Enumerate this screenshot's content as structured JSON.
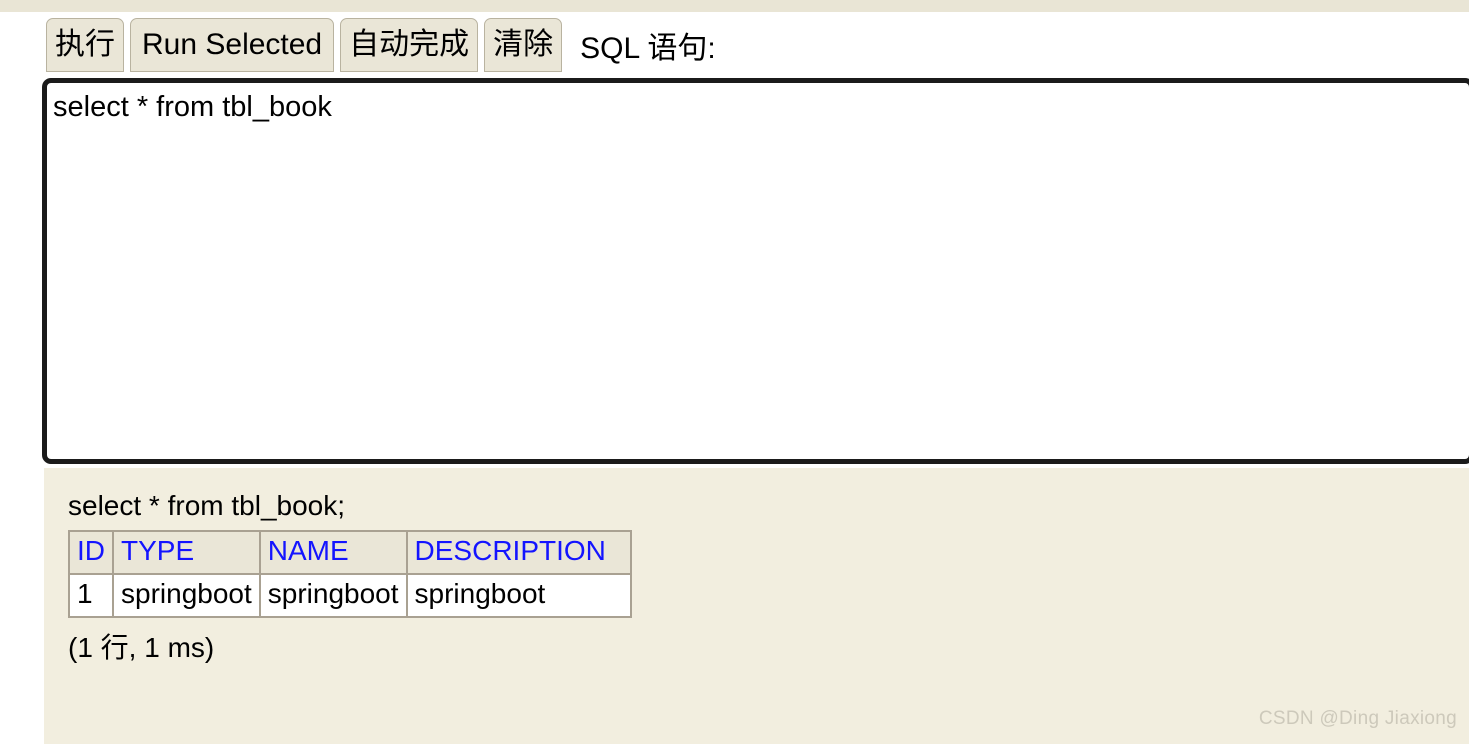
{
  "toolbar": {
    "buttons": [
      {
        "label": "执行",
        "name": "run-button",
        "cjk": true
      },
      {
        "label": "Run Selected",
        "name": "run-selected-button",
        "cjk": false
      },
      {
        "label": "自动完成",
        "name": "auto-complete-button",
        "cjk": true
      },
      {
        "label": "清除",
        "name": "clear-button",
        "cjk": true
      }
    ],
    "sql_label": "SQL 语句:"
  },
  "editor": {
    "value": "select * from tbl_book",
    "placeholder": ""
  },
  "results": {
    "query_echo": "select * from tbl_book;",
    "columns": [
      "ID",
      "TYPE",
      "NAME",
      "DESCRIPTION"
    ],
    "rows": [
      [
        "1",
        "springboot",
        "springboot",
        "springboot"
      ]
    ],
    "status": "(1 行, 1 ms)"
  },
  "watermark": {
    "text": "CSDN @Ding Jiaxiong"
  },
  "colors": {
    "panel_bg": "#f2eedf",
    "strip_bg": "#e9e5d5",
    "button_bg": "#eae6d7",
    "button_border": "#b9b3a0",
    "editor_border": "#1b1b1b",
    "table_border": "#a9a192",
    "header_text": "#1414ff",
    "watermark_text": "#cdc9bb"
  }
}
